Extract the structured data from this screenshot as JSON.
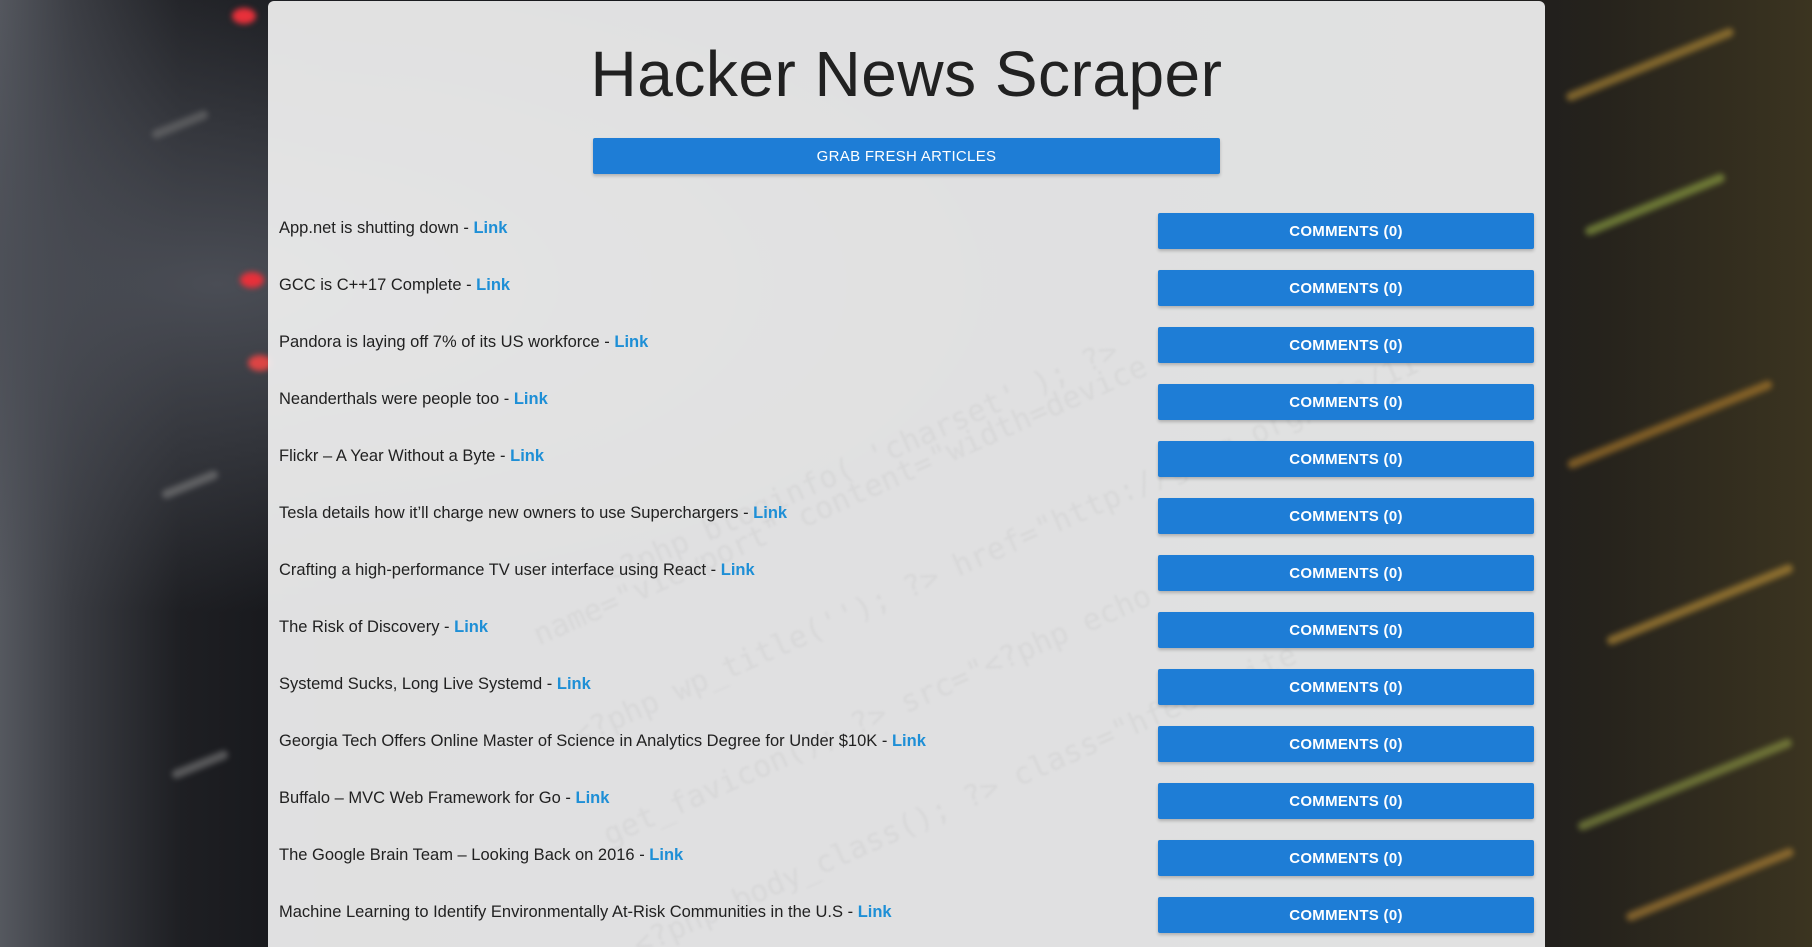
{
  "page": {
    "title": "Hacker News Scraper",
    "grab_button_label": "GRAB FRESH ARTICLES"
  },
  "articles": [
    {
      "title": "App.net is shutting down",
      "separator": " - ",
      "link_label": "Link",
      "comments_label": "COMMENTS (0)"
    },
    {
      "title": "GCC is C++17 Complete",
      "separator": " - ",
      "link_label": "Link",
      "comments_label": "COMMENTS (0)"
    },
    {
      "title": "Pandora is laying off 7% of its US workforce",
      "separator": " - ",
      "link_label": "Link",
      "comments_label": "COMMENTS (0)"
    },
    {
      "title": "Neanderthals were people too",
      "separator": " - ",
      "link_label": "Link",
      "comments_label": "COMMENTS (0)"
    },
    {
      "title": "Flickr – A Year Without a Byte",
      "separator": " - ",
      "link_label": "Link",
      "comments_label": "COMMENTS (0)"
    },
    {
      "title": "Tesla details how it’ll charge new owners to use Superchargers",
      "separator": " - ",
      "link_label": "Link",
      "comments_label": "COMMENTS (0)"
    },
    {
      "title": "Crafting a high-performance TV user interface using React",
      "separator": " - ",
      "link_label": "Link",
      "comments_label": "COMMENTS (0)"
    },
    {
      "title": "The Risk of Discovery",
      "separator": " - ",
      "link_label": "Link",
      "comments_label": "COMMENTS (0)"
    },
    {
      "title": "Systemd Sucks, Long Live Systemd",
      "separator": " - ",
      "link_label": "Link",
      "comments_label": "COMMENTS (0)"
    },
    {
      "title": "Georgia Tech Offers Online Master of Science in Analytics Degree for Under $10K",
      "separator": " - ",
      "link_label": "Link",
      "comments_label": "COMMENTS (0)"
    },
    {
      "title": "Buffalo – MVC Web Framework for Go",
      "separator": " - ",
      "link_label": "Link",
      "comments_label": "COMMENTS (0)"
    },
    {
      "title": "The Google Brain Team – Looking Back on 2016",
      "separator": " - ",
      "link_label": "Link",
      "comments_label": "COMMENTS (0)"
    },
    {
      "title": "Machine Learning to Identify Environmentally At-Risk Communities in the U.S",
      "separator": " - ",
      "link_label": "Link",
      "comments_label": "COMMENTS (0)"
    }
  ],
  "colors": {
    "accent": "#1e7dd6",
    "link": "#1e8fd6",
    "panel": "#f0f0f0",
    "text": "#212121"
  }
}
